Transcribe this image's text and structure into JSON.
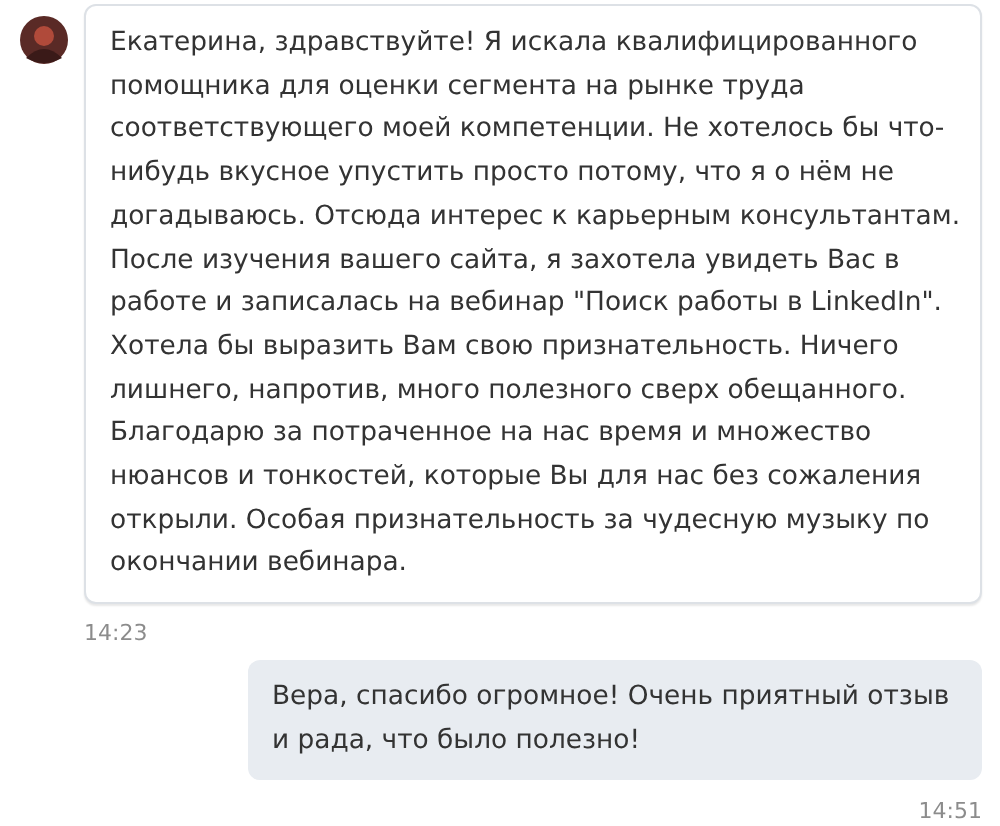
{
  "messages": [
    {
      "kind": "incoming",
      "text": "Екатерина, здравствуйте! Я искала квалифицированного помощника для оценки сегмента на рынке труда соответствующего моей компетенции. Не хотелось бы что-нибудь вкусное упустить просто потому, что я о нём не догадываюсь. Отсюда интерес к карьерным консультантам. После изучения вашего сайта, я захотела увидеть Вас в работе и записалась на вебинар \"Поиск работы в LinkedIn\". Хотела бы выразить Вам свою признательность. Ничего лишнего, напротив, много полезного сверх обещанного. Благодарю за потраченное на нас время и множество нюансов и тонкостей, которые Вы для нас без сожаления открыли. Особая признательность за чудесную музыку по окончании вебинара.",
      "time": "14:23"
    },
    {
      "kind": "outgoing",
      "text": "Вера, спасибо огромное! Очень приятный отзыв и рада, что было полезно!",
      "time": "14:51"
    }
  ]
}
